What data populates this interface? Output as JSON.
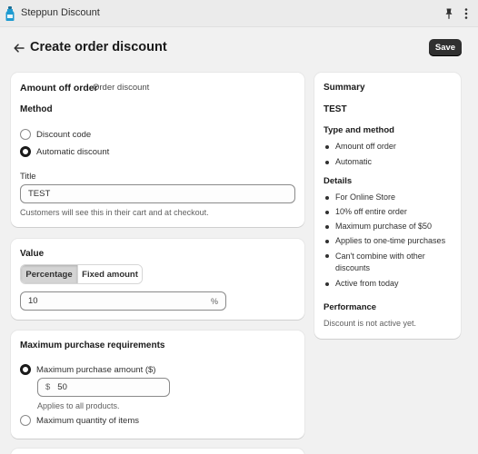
{
  "app": {
    "name": "Steppun Discount"
  },
  "page": {
    "title": "Create order discount",
    "save_label": "Save"
  },
  "amount_card": {
    "title": "Amount off order",
    "subtitle": "Order discount",
    "method_label": "Method",
    "options": [
      {
        "label": "Discount code",
        "selected": false
      },
      {
        "label": "Automatic discount",
        "selected": true
      }
    ],
    "title_field_label": "Title",
    "title_field_value": "TEST",
    "title_help": "Customers will see this in their cart and at checkout."
  },
  "value_card": {
    "title": "Value",
    "segments": [
      {
        "label": "Percentage",
        "active": true
      },
      {
        "label": "Fixed amount",
        "active": false
      }
    ],
    "value": "10",
    "suffix": "%"
  },
  "max_card": {
    "title": "Maximum purchase requirements",
    "option_amount_label": "Maximum purchase amount ($)",
    "amount_prefix": "$",
    "amount_value": "50",
    "amount_help": "Applies to all products.",
    "option_quantity_label": "Maximum quantity of items"
  },
  "summary": {
    "title": "Summary",
    "code": "TEST",
    "type_heading": "Type and method",
    "type_items": [
      "Amount off order",
      "Automatic"
    ],
    "details_heading": "Details",
    "details_items": [
      "For Online Store",
      "10% off entire order",
      "Maximum purchase of $50",
      "Applies to one-time purchases",
      "Can't combine with other discounts",
      "Active from today"
    ],
    "performance_heading": "Performance",
    "performance_text": "Discount is not active yet."
  },
  "icons": {
    "app": "app-bottle-icon",
    "pin": "pin-icon",
    "more": "more-vertical-icon",
    "back": "arrow-left-icon"
  },
  "colors": {
    "save_bg": "#303030",
    "page_bg": "#f1f1f1",
    "card_bg": "#ffffff",
    "app_icon": "#1f9bd1"
  }
}
